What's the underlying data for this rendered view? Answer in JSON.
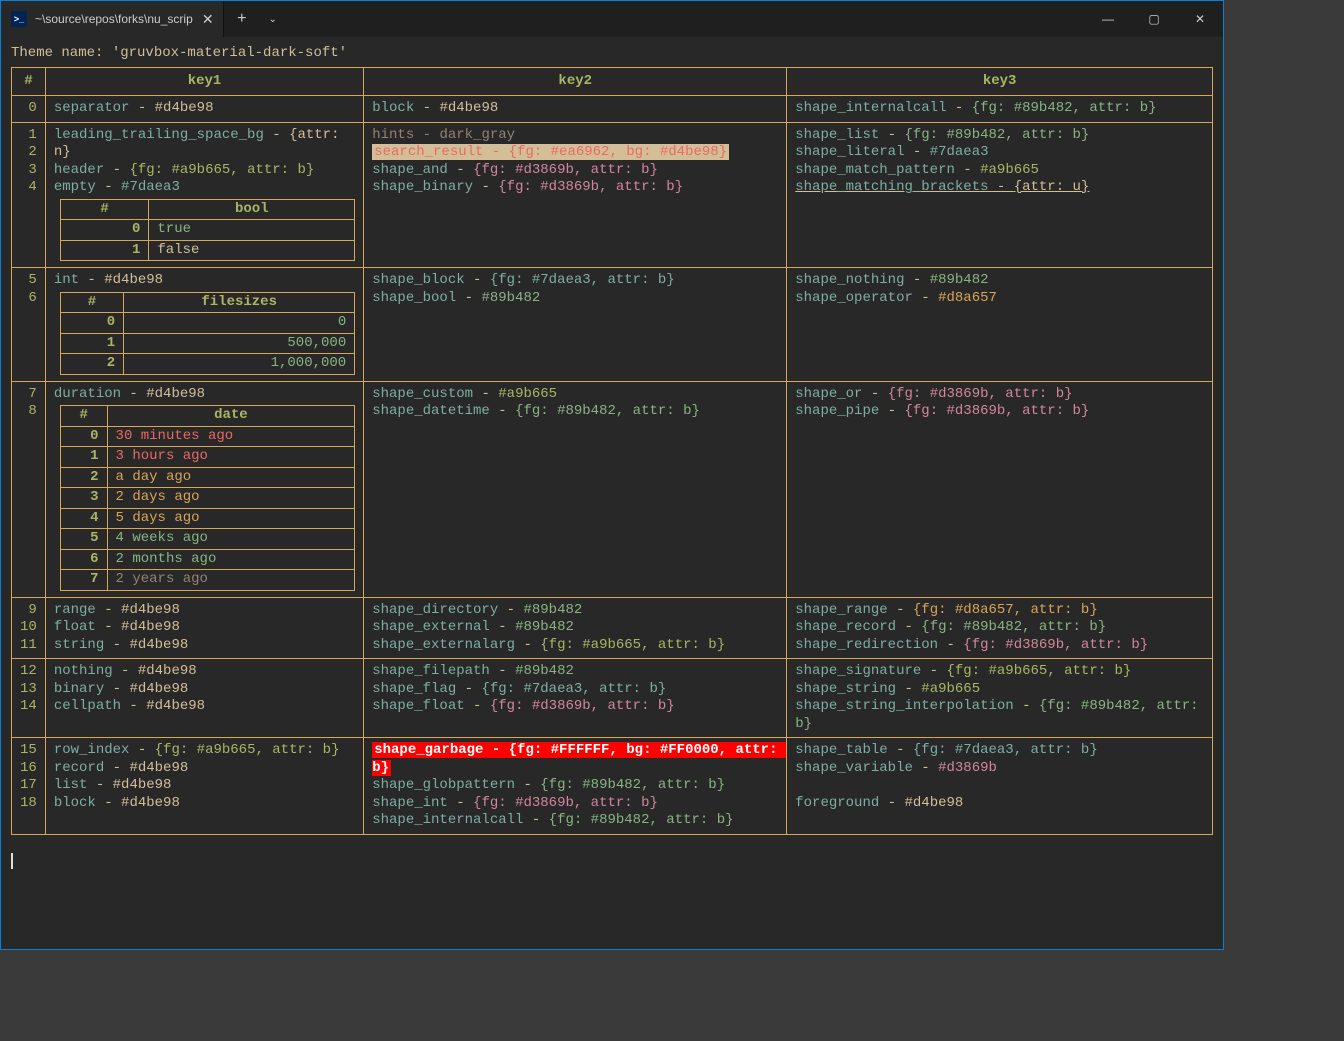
{
  "window": {
    "tab_title": "~\\source\\repos\\forks\\nu_scrip",
    "tab_icon_text": ">_"
  },
  "theme_line": "Theme name: 'gruvbox-material-dark-soft'",
  "headers": {
    "num": "#",
    "k1": "key1",
    "k2": "key2",
    "k3": "key3"
  },
  "rows": [
    {
      "nums": [
        "0"
      ],
      "k1": [
        {
          "key": "separator",
          "dash": " - ",
          "val": "#d4be98",
          "cls": "v-fg"
        }
      ],
      "k2": [
        {
          "key": "block",
          "dash": " - ",
          "val": "#d4be98",
          "cls": "v-fg"
        }
      ],
      "k3": [
        {
          "key": "shape_internalcall",
          "dash": " - ",
          "val": "{fg: #89b482, attr: b}",
          "cls": "v-blue"
        }
      ]
    },
    {
      "nums": [
        "1",
        "2",
        "3",
        "4"
      ],
      "k1": [
        {
          "key": "leading_trailing_space_bg",
          "dash": " - ",
          "val": "{attr: n}",
          "cls": "v-fg"
        },
        {
          "key": "header",
          "dash": " - ",
          "val": "{fg: #a9b665, attr: b}",
          "cls": "v-green"
        },
        {
          "key": "empty",
          "dash": " - ",
          "val": "#7daea3",
          "cls": "v-teal"
        },
        {
          "inner_table": "bool"
        }
      ],
      "k2": [
        {
          "key": "hints",
          "dash": " - ",
          "val": "dark_gray",
          "cls": "v-gray",
          "kcls": "v-gray",
          "dcls": "v-gray"
        },
        {
          "raw_search": "search_result - {fg: #ea6962, bg: #d4be98}"
        },
        {
          "key": "shape_and",
          "dash": " - ",
          "val": "{fg: #d3869b, attr: b}",
          "cls": "v-pink"
        },
        {
          "key": "shape_binary",
          "dash": " - ",
          "val": "{fg: #d3869b, attr: b}",
          "cls": "v-pink"
        }
      ],
      "k3": [
        {
          "key": "shape_list",
          "dash": " - ",
          "val": "{fg: #89b482, attr: b}",
          "cls": "v-blue"
        },
        {
          "key": "shape_literal",
          "dash": " - ",
          "val": "#7daea3",
          "cls": "v-teal"
        },
        {
          "key": "shape_match_pattern",
          "dash": " - ",
          "val": "#a9b665",
          "cls": "v-green"
        },
        {
          "key": "shape_matching_brackets",
          "dash": " - ",
          "val": "{attr: u}",
          "cls": "v-fg",
          "underline": true
        }
      ]
    },
    {
      "nums": [
        "5",
        "6"
      ],
      "k1": [
        {
          "key": "int",
          "dash": " - ",
          "val": "#d4be98",
          "cls": "v-fg"
        },
        {
          "inner_table": "filesizes"
        }
      ],
      "k2": [
        {
          "key": "shape_block",
          "dash": " - ",
          "val": "{fg: #7daea3, attr: b}",
          "cls": "v-teal"
        },
        {
          "key": "shape_bool",
          "dash": " - ",
          "val": "#89b482",
          "cls": "v-blue"
        }
      ],
      "k3": [
        {
          "key": "shape_nothing",
          "dash": " - ",
          "val": "#89b482",
          "cls": "v-blue"
        },
        {
          "key": "shape_operator",
          "dash": " - ",
          "val": "#d8a657",
          "cls": "v-yellow"
        }
      ]
    },
    {
      "nums": [
        "7",
        "8"
      ],
      "k1": [
        {
          "key": "duration",
          "dash": " - ",
          "val": "#d4be98",
          "cls": "v-fg"
        },
        {
          "inner_table": "date"
        }
      ],
      "k2": [
        {
          "key": "shape_custom",
          "dash": " - ",
          "val": "#a9b665",
          "cls": "v-green"
        },
        {
          "key": "shape_datetime",
          "dash": " - ",
          "val": "{fg: #89b482, attr: b}",
          "cls": "v-blue"
        }
      ],
      "k3": [
        {
          "key": "shape_or",
          "dash": " - ",
          "val": "{fg: #d3869b, attr: b}",
          "cls": "v-pink"
        },
        {
          "key": "shape_pipe",
          "dash": " - ",
          "val": "{fg: #d3869b, attr: b}",
          "cls": "v-pink"
        }
      ]
    },
    {
      "nums": [
        "9",
        "10",
        "11"
      ],
      "k1": [
        {
          "key": "range",
          "dash": " - ",
          "val": "#d4be98",
          "cls": "v-fg"
        },
        {
          "key": "float",
          "dash": " - ",
          "val": "#d4be98",
          "cls": "v-fg"
        },
        {
          "key": "string",
          "dash": " - ",
          "val": "#d4be98",
          "cls": "v-fg"
        }
      ],
      "k2": [
        {
          "key": "shape_directory",
          "dash": " - ",
          "val": "#89b482",
          "cls": "v-blue"
        },
        {
          "key": "shape_external",
          "dash": " - ",
          "val": "#89b482",
          "cls": "v-blue"
        },
        {
          "key": "shape_externalarg",
          "dash": " - ",
          "val": "{fg: #a9b665, attr: b}",
          "cls": "v-green"
        }
      ],
      "k3": [
        {
          "key": "shape_range",
          "dash": " - ",
          "val": "{fg: #d8a657, attr: b}",
          "cls": "v-yellow"
        },
        {
          "key": "shape_record",
          "dash": " - ",
          "val": "{fg: #89b482, attr: b}",
          "cls": "v-blue"
        },
        {
          "key": "shape_redirection",
          "dash": " - ",
          "val": "{fg: #d3869b, attr: b}",
          "cls": "v-pink"
        }
      ]
    },
    {
      "nums": [
        "12",
        "13",
        "14"
      ],
      "k1": [
        {
          "key": "nothing",
          "dash": " - ",
          "val": "#d4be98",
          "cls": "v-fg"
        },
        {
          "key": "binary",
          "dash": " - ",
          "val": "#d4be98",
          "cls": "v-fg"
        },
        {
          "key": "cellpath",
          "dash": " - ",
          "val": "#d4be98",
          "cls": "v-fg"
        }
      ],
      "k2": [
        {
          "key": "shape_filepath",
          "dash": " - ",
          "val": "#89b482",
          "cls": "v-blue"
        },
        {
          "key": "shape_flag",
          "dash": " - ",
          "val": "{fg: #7daea3, attr: b}",
          "cls": "v-teal"
        },
        {
          "key": "shape_float",
          "dash": " - ",
          "val": "{fg: #d3869b, attr: b}",
          "cls": "v-pink"
        }
      ],
      "k3": [
        {
          "key": "shape_signature",
          "dash": " - ",
          "val": "{fg: #a9b665, attr: b}",
          "cls": "v-green"
        },
        {
          "key": "shape_string",
          "dash": " - ",
          "val": "#a9b665",
          "cls": "v-green"
        },
        {
          "key": "shape_string_interpolation",
          "dash": " - ",
          "val": "{fg: #89b482, attr: b}",
          "cls": "v-blue"
        }
      ]
    },
    {
      "nums": [
        "15",
        "16",
        "17",
        "18"
      ],
      "k1": [
        {
          "key": "row_index",
          "dash": " - ",
          "val": "{fg: #a9b665, attr: b}",
          "cls": "v-green"
        },
        {
          "key": "record",
          "dash": " - ",
          "val": "#d4be98",
          "cls": "v-fg"
        },
        {
          "key": "list",
          "dash": " - ",
          "val": "#d4be98",
          "cls": "v-fg"
        },
        {
          "key": "block",
          "dash": " - ",
          "val": "#d4be98",
          "cls": "v-fg"
        }
      ],
      "k2": [
        {
          "raw_garbage": "shape_garbage - {fg: #FFFFFF, bg: #FF0000, attr: b}"
        },
        {
          "key": "shape_globpattern",
          "dash": " - ",
          "val": "{fg: #89b482, attr: b}",
          "cls": "v-blue"
        },
        {
          "key": "shape_int",
          "dash": " - ",
          "val": "{fg: #d3869b, attr: b}",
          "cls": "v-pink"
        },
        {
          "key": "shape_internalcall",
          "dash": " - ",
          "val": "{fg: #89b482, attr: b}",
          "cls": "v-blue"
        }
      ],
      "k3": [
        {
          "key": "shape_table",
          "dash": " - ",
          "val": "{fg: #7daea3, attr: b}",
          "cls": "v-teal"
        },
        {
          "key": "shape_variable",
          "dash": " - ",
          "val": "#d3869b",
          "cls": "v-pink"
        },
        {
          "blank": true
        },
        {
          "key": "foreground",
          "dash": " - ",
          "val": "#d4be98",
          "cls": "v-fg"
        }
      ]
    }
  ],
  "inner_tables": {
    "bool": {
      "header": "bool",
      "rows": [
        {
          "i": "0",
          "v": "true",
          "cls": "true"
        },
        {
          "i": "1",
          "v": "false",
          "cls": "false"
        }
      ]
    },
    "filesizes": {
      "header": "filesizes",
      "rows": [
        {
          "i": "0",
          "v": "0",
          "cls": "v-blue",
          "align": "right"
        },
        {
          "i": "1",
          "v": "500,000",
          "cls": "v-blue",
          "align": "right"
        },
        {
          "i": "2",
          "v": "1,000,000",
          "cls": "v-blue",
          "align": "right"
        }
      ]
    },
    "date": {
      "header": "date",
      "rows": [
        {
          "i": "0",
          "v": "30 minutes ago",
          "cls": "v-red"
        },
        {
          "i": "1",
          "v": "3 hours ago",
          "cls": "v-red"
        },
        {
          "i": "2",
          "v": "a day ago",
          "cls": "v-yellow"
        },
        {
          "i": "3",
          "v": "2 days ago",
          "cls": "v-yellow"
        },
        {
          "i": "4",
          "v": "5 days ago",
          "cls": "v-yellow"
        },
        {
          "i": "5",
          "v": "4 weeks ago",
          "cls": "v-blue"
        },
        {
          "i": "6",
          "v": "2 months ago",
          "cls": "v-blue"
        },
        {
          "i": "7",
          "v": "2 years ago",
          "cls": "v-gray"
        }
      ]
    }
  }
}
